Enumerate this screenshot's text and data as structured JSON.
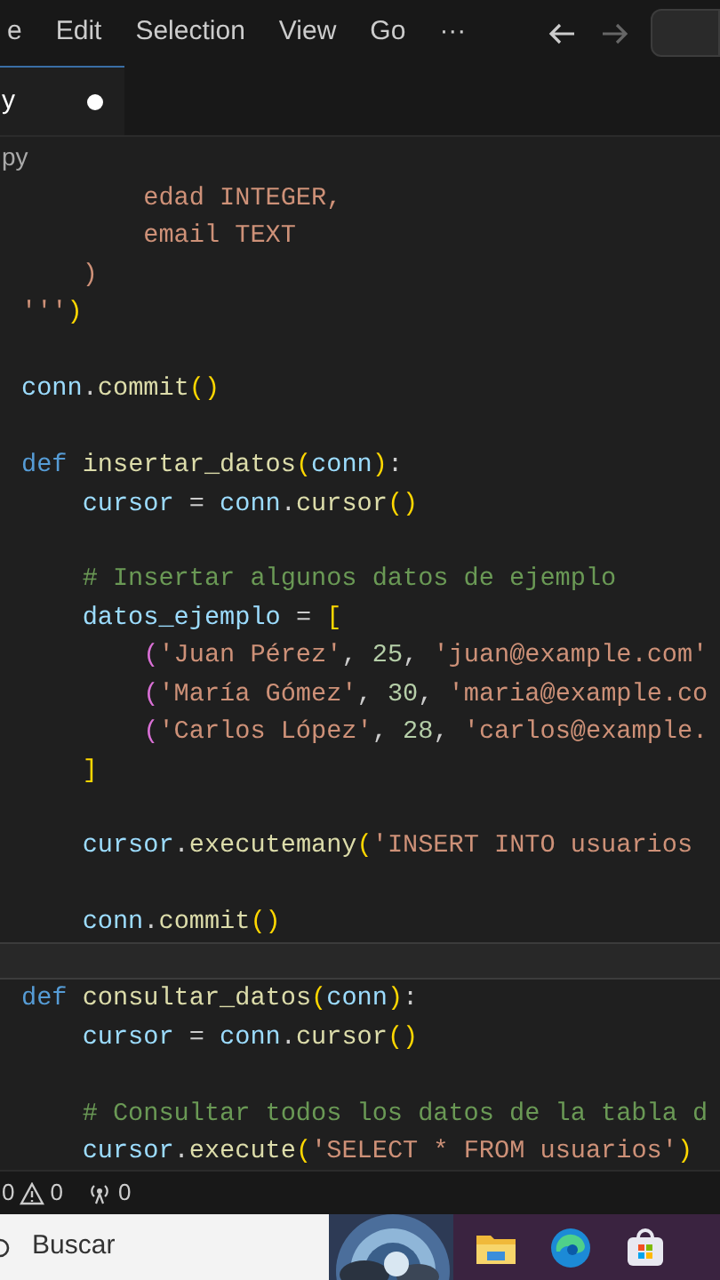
{
  "menu": {
    "items": [
      "e",
      "Edit",
      "Selection",
      "View",
      "Go",
      "···"
    ]
  },
  "tab": {
    "label": "y",
    "modified": true
  },
  "breadcrumb": "py",
  "code_lines": [
    {
      "highlighted": false,
      "tokens": [
        {
          "kind": "string",
          "text": "        edad INTEGER,"
        }
      ]
    },
    {
      "highlighted": false,
      "tokens": [
        {
          "kind": "string",
          "text": "        email TEXT"
        }
      ]
    },
    {
      "highlighted": false,
      "tokens": [
        {
          "kind": "string",
          "text": "    )"
        }
      ]
    },
    {
      "highlighted": false,
      "tokens": [
        {
          "kind": "string",
          "text": "'''"
        },
        {
          "kind": "bracket1",
          "text": ")"
        }
      ]
    },
    {
      "highlighted": false
    },
    {
      "highlighted": false,
      "tokens": [
        {
          "kind": "var",
          "text": "conn"
        },
        {
          "kind": "plain",
          "text": "."
        },
        {
          "kind": "func",
          "text": "commit"
        },
        {
          "kind": "bracket1",
          "text": "()"
        }
      ]
    },
    {
      "highlighted": false
    },
    {
      "highlighted": false,
      "tokens": [
        {
          "kind": "keyword",
          "text": "def "
        },
        {
          "kind": "func",
          "text": "insertar_datos"
        },
        {
          "kind": "bracket1",
          "text": "("
        },
        {
          "kind": "var",
          "text": "conn"
        },
        {
          "kind": "bracket1",
          "text": ")"
        },
        {
          "kind": "plain",
          "text": ":"
        }
      ]
    },
    {
      "highlighted": false,
      "tokens": [
        {
          "kind": "var",
          "text": "    cursor"
        },
        {
          "kind": "plain",
          "text": " = "
        },
        {
          "kind": "var",
          "text": "conn"
        },
        {
          "kind": "plain",
          "text": "."
        },
        {
          "kind": "func",
          "text": "cursor"
        },
        {
          "kind": "bracket1",
          "text": "()"
        }
      ]
    },
    {
      "highlighted": false
    },
    {
      "highlighted": false,
      "tokens": [
        {
          "kind": "comment",
          "text": "    # Insertar algunos datos de ejemplo"
        }
      ]
    },
    {
      "highlighted": false,
      "tokens": [
        {
          "kind": "var",
          "text": "    datos_ejemplo"
        },
        {
          "kind": "plain",
          "text": " = "
        },
        {
          "kind": "bracket1",
          "text": "["
        }
      ]
    },
    {
      "highlighted": false,
      "tokens": [
        {
          "kind": "bracket2",
          "text": "        ("
        },
        {
          "kind": "string",
          "text": "'Juan Pérez'"
        },
        {
          "kind": "plain",
          "text": ", "
        },
        {
          "kind": "number",
          "text": "25"
        },
        {
          "kind": "plain",
          "text": ", "
        },
        {
          "kind": "string",
          "text": "'juan@example.com'"
        }
      ]
    },
    {
      "highlighted": false,
      "tokens": [
        {
          "kind": "bracket2",
          "text": "        ("
        },
        {
          "kind": "string",
          "text": "'María Gómez'"
        },
        {
          "kind": "plain",
          "text": ", "
        },
        {
          "kind": "number",
          "text": "30"
        },
        {
          "kind": "plain",
          "text": ", "
        },
        {
          "kind": "string",
          "text": "'maria@example.co"
        }
      ]
    },
    {
      "highlighted": false,
      "tokens": [
        {
          "kind": "bracket2",
          "text": "        ("
        },
        {
          "kind": "string",
          "text": "'Carlos López'"
        },
        {
          "kind": "plain",
          "text": ", "
        },
        {
          "kind": "number",
          "text": "28"
        },
        {
          "kind": "plain",
          "text": ", "
        },
        {
          "kind": "string",
          "text": "'carlos@example."
        }
      ]
    },
    {
      "highlighted": false,
      "tokens": [
        {
          "kind": "bracket1",
          "text": "    ]"
        }
      ]
    },
    {
      "highlighted": false
    },
    {
      "highlighted": false,
      "tokens": [
        {
          "kind": "var",
          "text": "    cursor"
        },
        {
          "kind": "plain",
          "text": "."
        },
        {
          "kind": "func",
          "text": "executemany"
        },
        {
          "kind": "bracket1",
          "text": "("
        },
        {
          "kind": "string",
          "text": "'INSERT INTO usuarios"
        }
      ]
    },
    {
      "highlighted": false
    },
    {
      "highlighted": false,
      "tokens": [
        {
          "kind": "var",
          "text": "    conn"
        },
        {
          "kind": "plain",
          "text": "."
        },
        {
          "kind": "func",
          "text": "commit"
        },
        {
          "kind": "bracket1",
          "text": "()"
        }
      ]
    },
    {
      "highlighted": true
    },
    {
      "highlighted": false,
      "tokens": [
        {
          "kind": "keyword",
          "text": "def "
        },
        {
          "kind": "func",
          "text": "consultar_datos"
        },
        {
          "kind": "bracket1",
          "text": "("
        },
        {
          "kind": "var",
          "text": "conn"
        },
        {
          "kind": "bracket1",
          "text": ")"
        },
        {
          "kind": "plain",
          "text": ":"
        }
      ]
    },
    {
      "highlighted": false,
      "tokens": [
        {
          "kind": "var",
          "text": "    cursor"
        },
        {
          "kind": "plain",
          "text": " = "
        },
        {
          "kind": "var",
          "text": "conn"
        },
        {
          "kind": "plain",
          "text": "."
        },
        {
          "kind": "func",
          "text": "cursor"
        },
        {
          "kind": "bracket1",
          "text": "()"
        }
      ]
    },
    {
      "highlighted": false
    },
    {
      "highlighted": false,
      "tokens": [
        {
          "kind": "comment",
          "text": "    # Consultar todos los datos de la tabla d"
        }
      ]
    },
    {
      "highlighted": false,
      "tokens": [
        {
          "kind": "var",
          "text": "    cursor"
        },
        {
          "kind": "plain",
          "text": "."
        },
        {
          "kind": "func",
          "text": "execute"
        },
        {
          "kind": "bracket1",
          "text": "("
        },
        {
          "kind": "string",
          "text": "'SELECT * FROM usuarios'"
        },
        {
          "kind": "bracket1",
          "text": ")"
        }
      ]
    }
  ],
  "status_bar": {
    "errors": "0",
    "warnings": "0",
    "ports": "0"
  },
  "taskbar": {
    "search_placeholder": "Buscar"
  }
}
